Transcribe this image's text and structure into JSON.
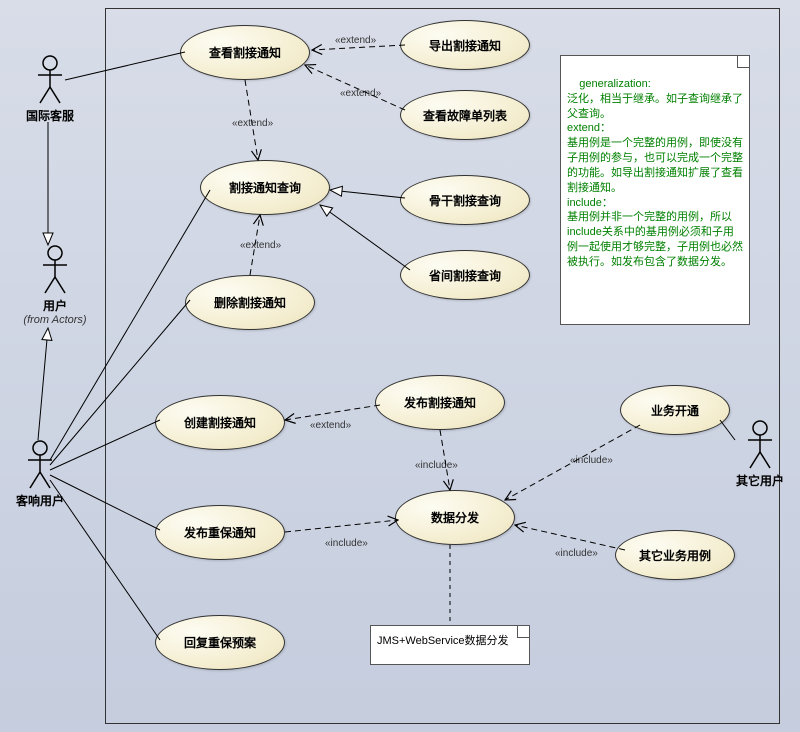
{
  "diagram_type": "UML Use Case Diagram",
  "actors": {
    "intl_cs": "国际客服",
    "user": "用户",
    "user_sub": "(from Actors)",
    "cx_user": "客响用户",
    "other_user": "其它用户"
  },
  "usecases": {
    "view_cut_notice": "查看割接通知",
    "export_cut_notice": "导出割接通知",
    "view_fault_list": "查看故障单列表",
    "cut_notice_query": "割接通知查询",
    "backbone_query": "骨干割接查询",
    "prov_query": "省间割接查询",
    "delete_cut_notice": "删除割接通知",
    "create_cut_notice": "创建割接通知",
    "publish_cut_notice": "发布割接通知",
    "biz_open": "业务开通",
    "publish_heavy_notice": "发布重保通知",
    "data_dispatch": "数据分发",
    "other_biz_uc": "其它业务用例",
    "reply_heavy_plan": "回复重保预案"
  },
  "stereotypes": {
    "extend": "«extend»",
    "include": "«include»"
  },
  "notes": {
    "main": "generalization:\n泛化，相当于继承。如子查询继承了父查询。\nextend：\n基用例是一个完整的用例，即使没有子用例的参与，也可以完成一个完整的功能。如导出割接通知扩展了查看割接通知。\ninclude：\n基用例并非一个完整的用例，所以include关系中的基用例必须和子用例一起使用才够完整，子用例也必然被执行。如发布包含了数据分发。",
    "small": "JMS+WebService数据分发"
  },
  "chart_data": {
    "type": "table",
    "title": "UML Use Case Relationships",
    "rows": [
      {
        "from": "导出割接通知",
        "to": "查看割接通知",
        "rel": "extend"
      },
      {
        "from": "查看故障单列表",
        "to": "查看割接通知",
        "rel": "extend"
      },
      {
        "from": "查看割接通知",
        "to": "割接通知查询",
        "rel": "extend"
      },
      {
        "from": "删除割接通知",
        "to": "割接通知查询",
        "rel": "extend"
      },
      {
        "from": "骨干割接查询",
        "to": "割接通知查询",
        "rel": "generalization"
      },
      {
        "from": "省间割接查询",
        "to": "割接通知查询",
        "rel": "generalization"
      },
      {
        "from": "发布割接通知",
        "to": "创建割接通知",
        "rel": "extend"
      },
      {
        "from": "发布割接通知",
        "to": "数据分发",
        "rel": "include"
      },
      {
        "from": "发布重保通知",
        "to": "数据分发",
        "rel": "include"
      },
      {
        "from": "业务开通",
        "to": "数据分发",
        "rel": "include"
      },
      {
        "from": "其它业务用例",
        "to": "数据分发",
        "rel": "include"
      },
      {
        "from": "国际客服",
        "to": "查看割接通知",
        "rel": "association"
      },
      {
        "from": "客响用户",
        "to": "割接通知查询",
        "rel": "association"
      },
      {
        "from": "客响用户",
        "to": "删除割接通知",
        "rel": "association"
      },
      {
        "from": "客响用户",
        "to": "创建割接通知",
        "rel": "association"
      },
      {
        "from": "客响用户",
        "to": "发布重保通知",
        "rel": "association"
      },
      {
        "from": "客响用户",
        "to": "回复重保预案",
        "rel": "association"
      },
      {
        "from": "其它用户",
        "to": "业务开通",
        "rel": "association"
      },
      {
        "from": "国际客服",
        "to": "用户",
        "rel": "generalization"
      },
      {
        "from": "客响用户",
        "to": "用户",
        "rel": "generalization"
      },
      {
        "from": "数据分发",
        "to": "JMS+WebService数据分发",
        "rel": "note-anchor"
      }
    ]
  }
}
